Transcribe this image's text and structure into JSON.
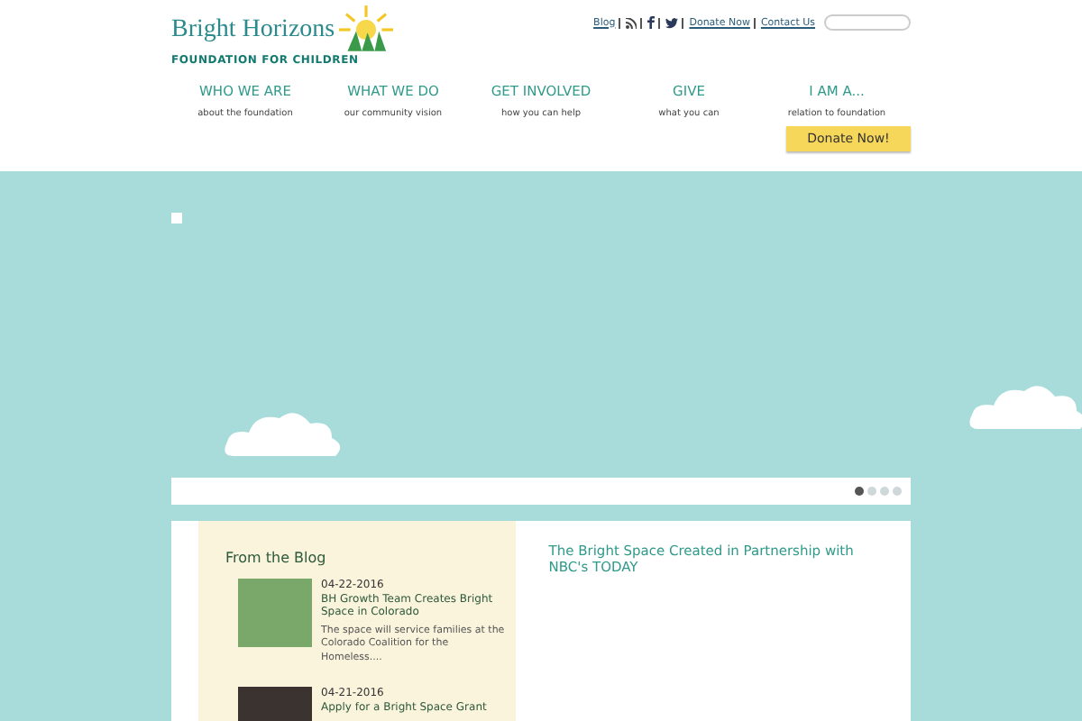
{
  "logo": {
    "name": "Bright Horizons",
    "tagline": "FOUNDATION FOR CHILDREN"
  },
  "top_links": [
    {
      "kind": "text",
      "label": "Blog"
    },
    {
      "kind": "rss"
    },
    {
      "kind": "facebook"
    },
    {
      "kind": "twitter"
    },
    {
      "kind": "text",
      "label": "Donate Now"
    },
    {
      "kind": "text",
      "label": "Contact Us"
    }
  ],
  "nav": [
    {
      "label": "WHO WE ARE",
      "sub": "about the foundation"
    },
    {
      "label": "WHAT WE DO",
      "sub": "our community vision"
    },
    {
      "label": "GET INVOLVED",
      "sub": "how you can help"
    },
    {
      "label": "GIVE",
      "sub": "what you can"
    },
    {
      "label": "I AM A...",
      "sub": "relation to foundation"
    }
  ],
  "donate_button": "Donate Now!",
  "slider_dots": [
    {
      "selected": true
    },
    {
      "selected": false
    },
    {
      "selected": false
    },
    {
      "selected": false
    }
  ],
  "blog": {
    "title": "From the Blog",
    "posts": [
      {
        "date": "04-22-2016",
        "title": "BH Growth Team Creates Bright Space in Colorado",
        "excerpt": "The space will service families at the Colorado Coalition for the Homeless...."
      },
      {
        "date": "04-21-2016",
        "title": "Apply for a Bright Space Grant"
      }
    ]
  },
  "feature_title": "The Bright Space Created in Partnership with NBC's TODAY"
}
